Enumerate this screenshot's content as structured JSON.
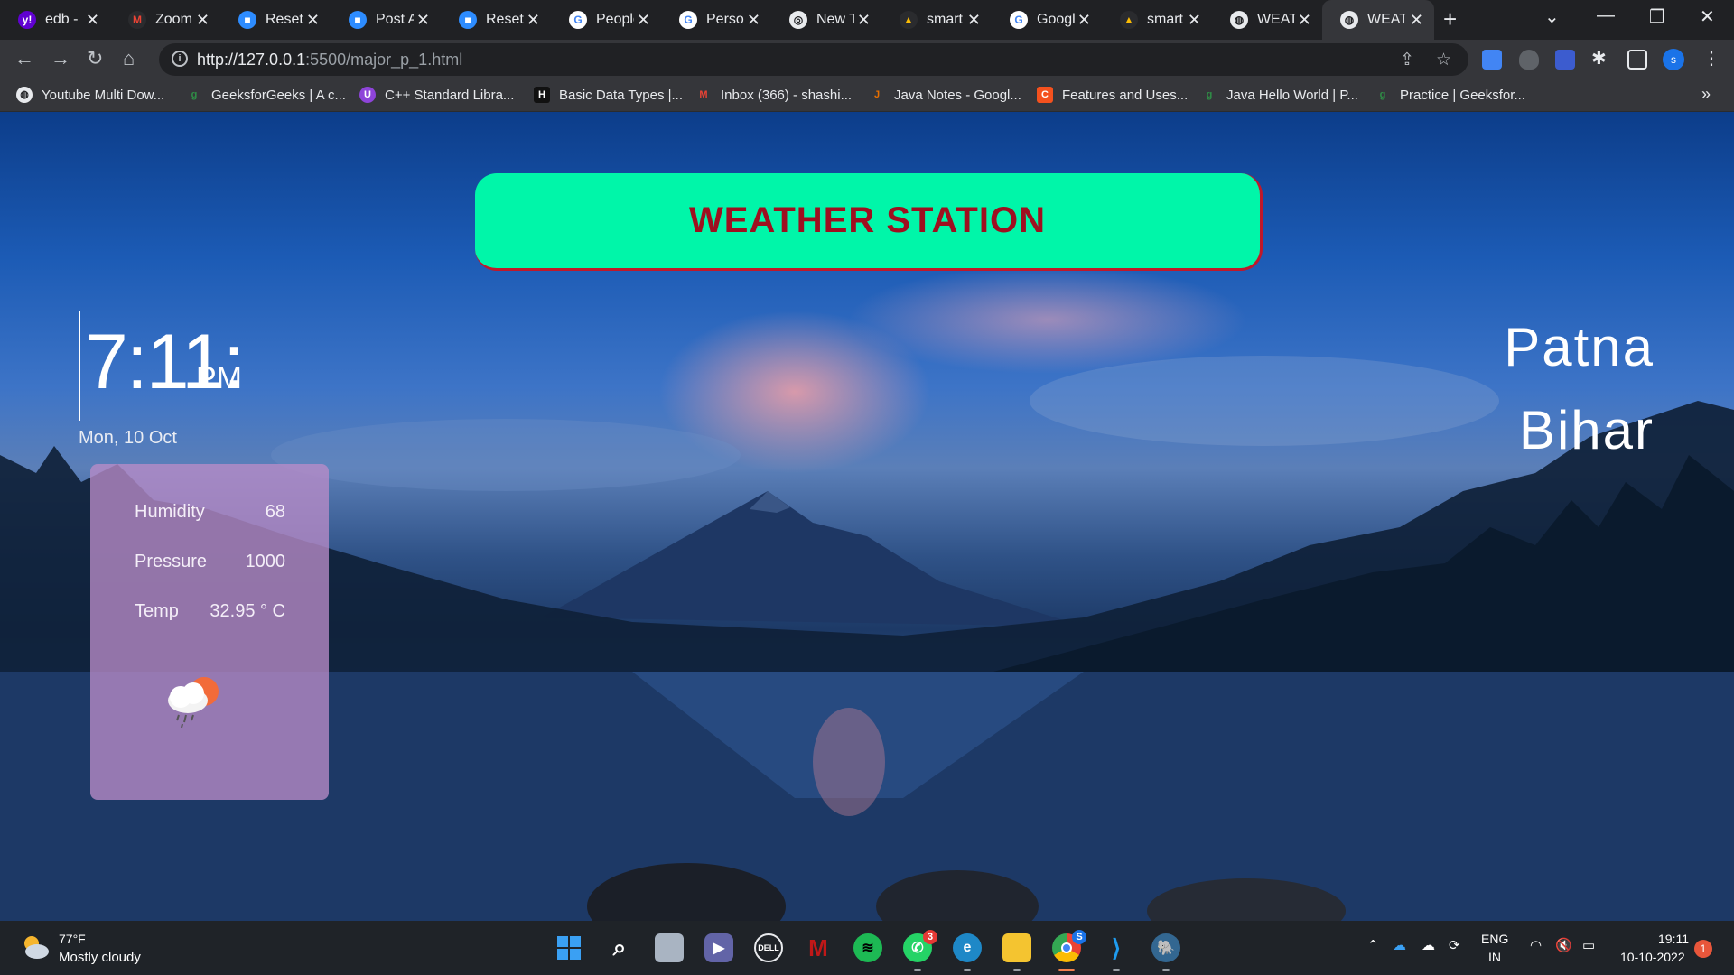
{
  "browser": {
    "tabs": [
      {
        "title": "edb -",
        "icon": "yahoo-icon",
        "color": "#6001d2",
        "glyph": "y!"
      },
      {
        "title": "Zoom",
        "icon": "gmail-icon",
        "color": "#2a2b2e",
        "glyph": "M"
      },
      {
        "title": "Reset",
        "icon": "zoom-icon",
        "color": "#2d8cff",
        "glyph": "■"
      },
      {
        "title": "Post A",
        "icon": "zoom-icon",
        "color": "#2d8cff",
        "glyph": "■"
      },
      {
        "title": "Reset",
        "icon": "zoom-icon",
        "color": "#2d8cff",
        "glyph": "■"
      },
      {
        "title": "People",
        "icon": "google-icon",
        "color": "#2a2b2e",
        "glyph": "G"
      },
      {
        "title": "Person",
        "icon": "google-icon",
        "color": "#2a2b2e",
        "glyph": "G"
      },
      {
        "title": "New T",
        "icon": "chrome-icon",
        "color": "#2a2b2e",
        "glyph": "◎"
      },
      {
        "title": "smart",
        "icon": "drive-icon",
        "color": "#2a2b2e",
        "glyph": "▲"
      },
      {
        "title": "Googl",
        "icon": "google-icon",
        "color": "#2a2b2e",
        "glyph": "G"
      },
      {
        "title": "smart",
        "icon": "drive-icon",
        "color": "#2a2b2e",
        "glyph": "▲"
      },
      {
        "title": "WEAT",
        "icon": "globe-icon",
        "color": "#2a2b2e",
        "glyph": "◍"
      },
      {
        "title": "WEAT",
        "icon": "globe-icon",
        "color": "#2a2b2e",
        "glyph": "◍",
        "active": true
      }
    ],
    "url_host": "http://127.0.0.1",
    "url_path": ":5500/major_p_1.html",
    "bookmarks": [
      {
        "label": "Youtube Multi Dow...",
        "icon": "globe-icon",
        "color": "#5f6368",
        "glyph": "◍"
      },
      {
        "label": "GeeksforGeeks | A c...",
        "icon": "gfg-icon",
        "color": "#2f8d46",
        "glyph": "ɡ"
      },
      {
        "label": "C++ Standard Libra...",
        "icon": "udemy-icon",
        "color": "#8e44d9",
        "glyph": "U"
      },
      {
        "label": "Basic Data Types |...",
        "icon": "hackerrank-icon",
        "color": "#111111",
        "glyph": "H"
      },
      {
        "label": "Inbox (366) - shashi...",
        "icon": "gmail-icon",
        "color": "#c5221f",
        "glyph": "M"
      },
      {
        "label": "Java Notes - Googl...",
        "icon": "java-icon",
        "color": "#e76f00",
        "glyph": "J"
      },
      {
        "label": "Features and Uses...",
        "icon": "bookmark-icon",
        "color": "#f4511e",
        "glyph": "C"
      },
      {
        "label": "Java Hello World | P...",
        "icon": "gfg-icon",
        "color": "#2f8d46",
        "glyph": "ɡ"
      },
      {
        "label": "Practice | Geeksfor...",
        "icon": "gfg-icon",
        "color": "#2f8d46",
        "glyph": "ɡ"
      }
    ]
  },
  "page": {
    "banner_title": "WEATHER STATION",
    "clock": "7:11:",
    "ampm": "PM",
    "date": "Mon, 10 Oct",
    "city": "Patna",
    "state": "Bihar",
    "card": {
      "humidity_label": "Humidity",
      "humidity_value": "68",
      "pressure_label": "Pressure",
      "pressure_value": "1000",
      "temp_label": "Temp",
      "temp_value": "32.95 ° C"
    }
  },
  "taskbar": {
    "weather_temp": "77°F",
    "weather_desc": "Mostly cloudy",
    "whatsapp_badge": "3",
    "chrome_badge": "S",
    "lang_primary": "ENG",
    "lang_secondary": "IN",
    "time": "19:11",
    "date": "10-10-2022",
    "notifications": "1"
  }
}
